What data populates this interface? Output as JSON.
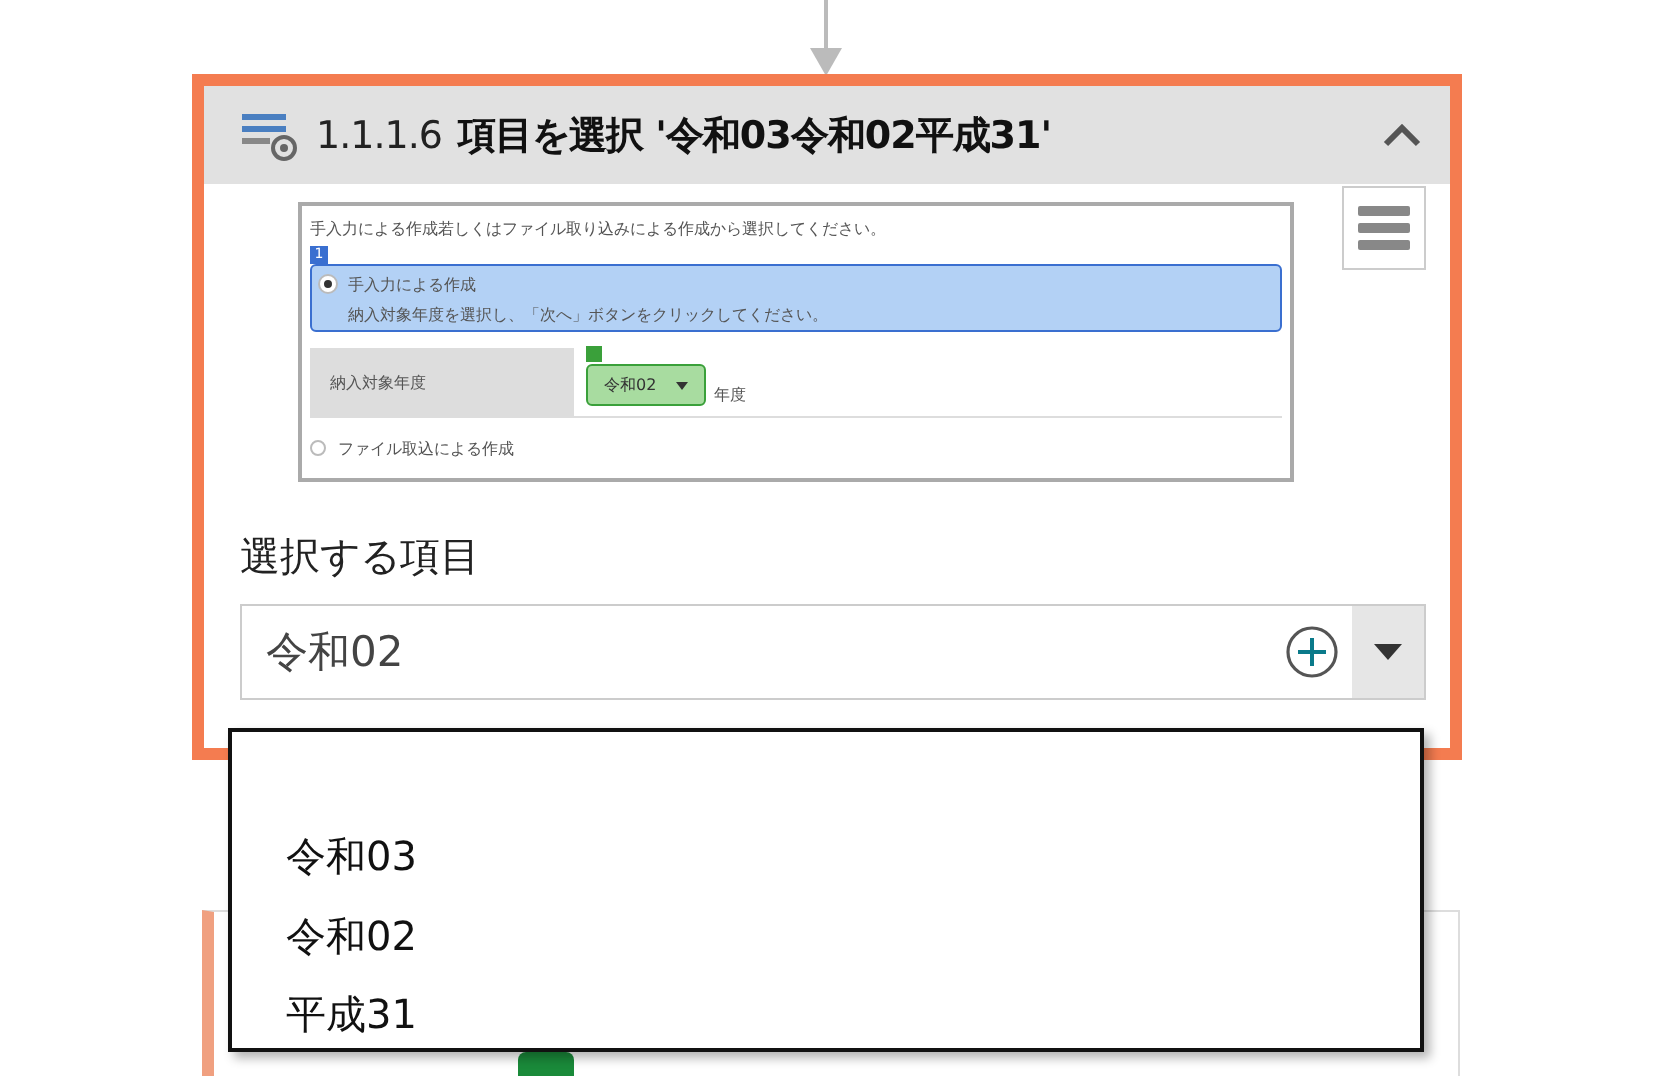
{
  "step": {
    "number": "1.1.1.6",
    "title": "項目を選択 '令和03令和02平成31'",
    "expanded": true
  },
  "preview": {
    "instruction": "手入力による作成若しくはファイル取り込みによる作成から選択してください。",
    "badge": "1",
    "options": [
      {
        "label": "手入力による作成",
        "selected": true,
        "note": "納入対象年度を選択し、「次へ」ボタンをクリックしてください。"
      },
      {
        "label": "ファイル取込による作成",
        "selected": false
      }
    ],
    "field_label": "納入対象年度",
    "field_value": "令和02",
    "field_suffix": "年度"
  },
  "select": {
    "label": "選択する項目",
    "value": "令和02",
    "open": true,
    "options": [
      "令和03",
      "令和02",
      "平成31"
    ]
  }
}
